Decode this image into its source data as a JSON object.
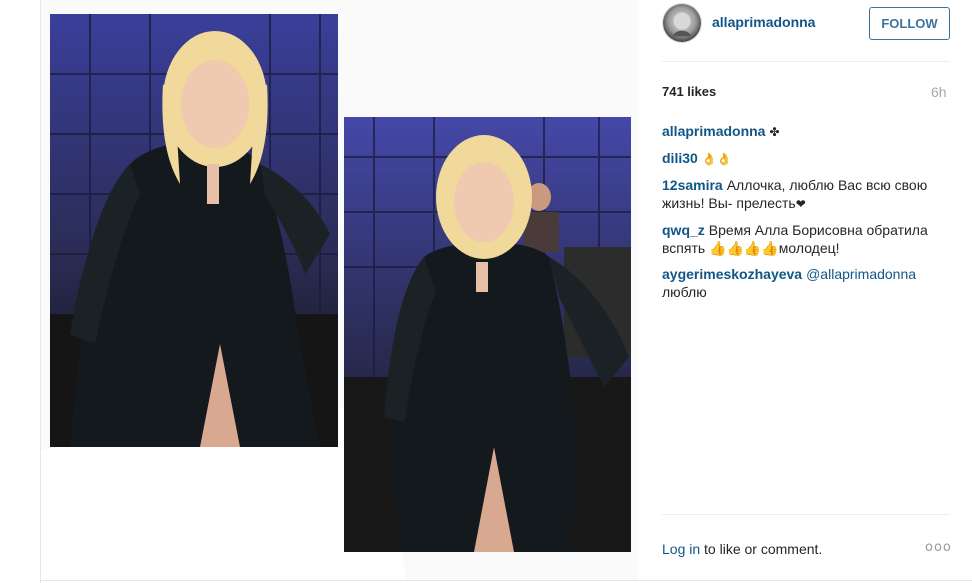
{
  "post": {
    "username": "allaprimadonna",
    "follow_label": "FOLLOW",
    "likes": "741 likes",
    "time": "6h"
  },
  "comments": [
    {
      "user": "allaprimadonna",
      "text": "",
      "emoji": "✤"
    },
    {
      "user": "dili30",
      "text": "",
      "emoji": "👌👌"
    },
    {
      "user": "12samira",
      "text": "Аллочка, люблю Вас всю свою жизнь! Вы- прелесть",
      "emoji": "❤"
    },
    {
      "user": "qwq_z",
      "text": "Время Алла Борисовна обратила вспять 👍👍👍👍молодец!",
      "emoji": ""
    },
    {
      "user": "aygerimeskozhayeva",
      "mention": "@allaprimadonna",
      "text": "люблю"
    }
  ],
  "footer": {
    "login_link": "Log in",
    "login_text": "to like or comment.",
    "more_icon": "ooo"
  },
  "icons": {
    "avatar": "avatar-image",
    "more": "more-options-icon"
  },
  "colors": {
    "link": "#125688",
    "follow": "#3f729b",
    "muted": "#a5a7aa"
  }
}
